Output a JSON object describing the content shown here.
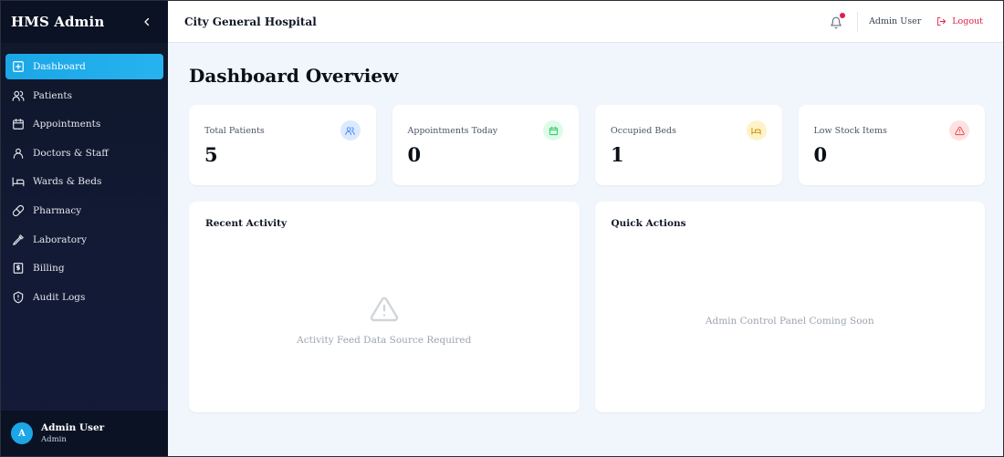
{
  "sidebar": {
    "brand": "HMS Admin",
    "items": [
      {
        "label": "Dashboard",
        "icon": "dashboard-icon",
        "active": true
      },
      {
        "label": "Patients",
        "icon": "users-icon"
      },
      {
        "label": "Appointments",
        "icon": "calendar-icon"
      },
      {
        "label": "Doctors & Staff",
        "icon": "user-icon"
      },
      {
        "label": "Wards & Beds",
        "icon": "bed-icon"
      },
      {
        "label": "Pharmacy",
        "icon": "pill-icon"
      },
      {
        "label": "Laboratory",
        "icon": "pipette-icon"
      },
      {
        "label": "Billing",
        "icon": "receipt-icon"
      },
      {
        "label": "Audit Logs",
        "icon": "shield-icon"
      }
    ],
    "user": {
      "initial": "A",
      "name": "Admin User",
      "role": "Admin"
    }
  },
  "header": {
    "hospital": "City General Hospital",
    "user": "Admin User",
    "logout": "Logout"
  },
  "page": {
    "title": "Dashboard Overview"
  },
  "stats": [
    {
      "label": "Total Patients",
      "value": "5",
      "icon": "users-icon",
      "color": "#3b82f6",
      "bg": "#dbeafe"
    },
    {
      "label": "Appointments Today",
      "value": "0",
      "icon": "calendar-icon",
      "color": "#22c55e",
      "bg": "#dcfce7"
    },
    {
      "label": "Occupied Beds",
      "value": "1",
      "icon": "bed-icon",
      "color": "#eab308",
      "bg": "#fef3c7"
    },
    {
      "label": "Low Stock Items",
      "value": "0",
      "icon": "alert-triangle-icon",
      "color": "#ef4444",
      "bg": "#fee2e2"
    }
  ],
  "panels": {
    "activity": {
      "title": "Recent Activity",
      "empty": "Activity Feed Data Source Required"
    },
    "actions": {
      "title": "Quick Actions",
      "empty": "Admin Control Panel Coming Soon"
    }
  },
  "colors": {
    "accent": "#1ba6e6",
    "sidebar": "#0f172a",
    "danger": "#e11d48",
    "background": "#f1f6fc"
  }
}
